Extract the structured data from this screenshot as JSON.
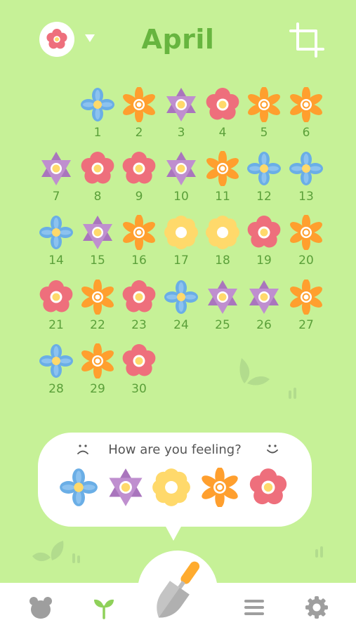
{
  "header": {
    "month": "April",
    "avatar_icon": "flower-avatar-icon",
    "crop_icon": "crop-icon"
  },
  "colors": {
    "background": "#c6f197",
    "title": "#67b53f",
    "day_number": "#5ba03a",
    "blue_flower": "#6aaee6",
    "purple_flower": "#a975bd",
    "yellow_flower": "#ffd96b",
    "orange_flower": "#ff9f2e",
    "pink_flower": "#ee6f7c"
  },
  "calendar": {
    "days": [
      {
        "num": "1",
        "mood": "blue"
      },
      {
        "num": "2",
        "mood": "orange"
      },
      {
        "num": "3",
        "mood": "purple"
      },
      {
        "num": "4",
        "mood": "pink"
      },
      {
        "num": "5",
        "mood": "orange"
      },
      {
        "num": "6",
        "mood": "orange"
      },
      {
        "num": "7",
        "mood": "purple"
      },
      {
        "num": "8",
        "mood": "pink"
      },
      {
        "num": "9",
        "mood": "pink"
      },
      {
        "num": "10",
        "mood": "purple"
      },
      {
        "num": "11",
        "mood": "orange"
      },
      {
        "num": "12",
        "mood": "blue"
      },
      {
        "num": "13",
        "mood": "blue"
      },
      {
        "num": "14",
        "mood": "blue"
      },
      {
        "num": "15",
        "mood": "purple"
      },
      {
        "num": "16",
        "mood": "orange"
      },
      {
        "num": "17",
        "mood": "yellow"
      },
      {
        "num": "18",
        "mood": "yellow"
      },
      {
        "num": "19",
        "mood": "pink"
      },
      {
        "num": "20",
        "mood": "orange"
      },
      {
        "num": "21",
        "mood": "pink"
      },
      {
        "num": "22",
        "mood": "orange"
      },
      {
        "num": "23",
        "mood": "pink"
      },
      {
        "num": "24",
        "mood": "blue"
      },
      {
        "num": "25",
        "mood": "purple"
      },
      {
        "num": "26",
        "mood": "purple"
      },
      {
        "num": "27",
        "mood": "orange"
      },
      {
        "num": "28",
        "mood": "blue"
      },
      {
        "num": "29",
        "mood": "orange"
      },
      {
        "num": "30",
        "mood": "pink"
      }
    ]
  },
  "mood_picker": {
    "question": "How are you feeling?",
    "low_icon": "sad-face-icon",
    "high_icon": "happy-face-icon",
    "options": [
      "blue",
      "purple",
      "yellow",
      "orange",
      "pink"
    ]
  },
  "nav": {
    "items": [
      "bear-icon",
      "sprout-icon",
      "trowel-icon",
      "list-icon",
      "settings-icon"
    ],
    "active": "sprout-icon"
  }
}
